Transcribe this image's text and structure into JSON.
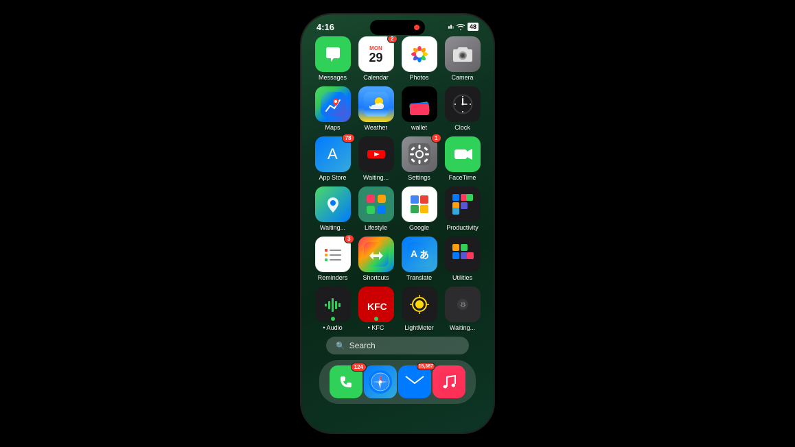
{
  "phone": {
    "status": {
      "time": "4:16",
      "battery": "48",
      "signal_bars": [
        3,
        4,
        5,
        6
      ],
      "has_wifi": true
    },
    "rows": [
      {
        "apps": [
          {
            "id": "messages",
            "label": "Messages",
            "badge": null,
            "dot": null
          },
          {
            "id": "calendar",
            "label": "Calendar",
            "badge": "2",
            "dot": null
          },
          {
            "id": "photos",
            "label": "Photos",
            "badge": null,
            "dot": null
          },
          {
            "id": "camera",
            "label": "Camera",
            "badge": null,
            "dot": null
          }
        ]
      },
      {
        "apps": [
          {
            "id": "maps",
            "label": "Maps",
            "badge": null,
            "dot": null
          },
          {
            "id": "weather",
            "label": "Weather",
            "badge": null,
            "dot": null
          },
          {
            "id": "wallet",
            "label": "Wallet",
            "badge": null,
            "dot": null
          },
          {
            "id": "clock",
            "label": "Clock",
            "badge": null,
            "dot": null
          }
        ]
      },
      {
        "apps": [
          {
            "id": "appstore",
            "label": "App Store",
            "badge": "78",
            "dot": null
          },
          {
            "id": "youtube",
            "label": "Waiting...",
            "badge": null,
            "dot": null
          },
          {
            "id": "settings",
            "label": "Settings",
            "badge": "1",
            "dot": null
          },
          {
            "id": "facetime",
            "label": "FaceTime",
            "badge": null,
            "dot": null
          }
        ]
      },
      {
        "apps": [
          {
            "id": "waiting-maps",
            "label": "Waiting...",
            "badge": null,
            "dot": null
          },
          {
            "id": "lifestyle",
            "label": "Lifestyle",
            "badge": null,
            "dot": null
          },
          {
            "id": "google",
            "label": "Google",
            "badge": null,
            "dot": null
          },
          {
            "id": "productivity",
            "label": "Productivity",
            "badge": null,
            "dot": null
          }
        ]
      },
      {
        "apps": [
          {
            "id": "reminders",
            "label": "Reminders",
            "badge": "3",
            "dot": null
          },
          {
            "id": "shortcuts",
            "label": "Shortcuts",
            "badge": null,
            "dot": null
          },
          {
            "id": "translate",
            "label": "Translate",
            "badge": null,
            "dot": null
          },
          {
            "id": "utilities",
            "label": "Utilities",
            "badge": null,
            "dot": null
          }
        ]
      },
      {
        "apps": [
          {
            "id": "audio",
            "label": "Audio",
            "badge": null,
            "dot": "green"
          },
          {
            "id": "kfc",
            "label": "KFC",
            "badge": null,
            "dot": "green"
          },
          {
            "id": "lightmeter",
            "label": "LightMeter",
            "badge": null,
            "dot": null
          },
          {
            "id": "waiting-last",
            "label": "Waiting...",
            "badge": null,
            "dot": null
          }
        ]
      }
    ],
    "search": {
      "placeholder": "Search",
      "icon": "search"
    },
    "dock": [
      {
        "id": "phone",
        "label": "",
        "badge": "124"
      },
      {
        "id": "safari",
        "label": "",
        "badge": null
      },
      {
        "id": "mail",
        "label": "",
        "badge": "15,387"
      },
      {
        "id": "music",
        "label": "",
        "badge": null
      }
    ],
    "calendar": {
      "month": "MON",
      "day": "29"
    }
  }
}
